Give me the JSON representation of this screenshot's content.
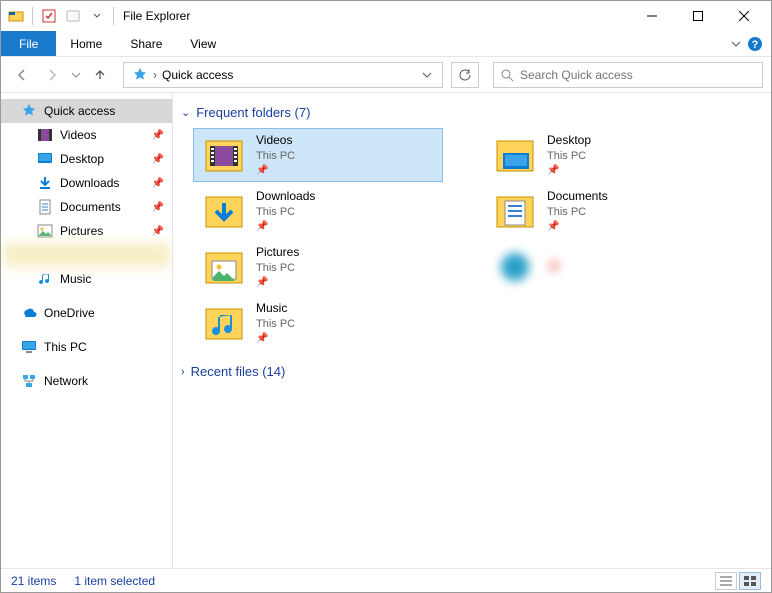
{
  "window": {
    "title": "File Explorer"
  },
  "ribbon": {
    "file": "File",
    "tabs": [
      "Home",
      "Share",
      "View"
    ]
  },
  "address": {
    "location": "Quick access"
  },
  "search": {
    "placeholder": "Search Quick access"
  },
  "sidebar": {
    "quick_access": "Quick access",
    "items": [
      {
        "label": "Videos",
        "pinned": true
      },
      {
        "label": "Desktop",
        "pinned": true
      },
      {
        "label": "Downloads",
        "pinned": true
      },
      {
        "label": "Documents",
        "pinned": true
      },
      {
        "label": "Pictures",
        "pinned": true
      }
    ],
    "music": "Music",
    "onedrive": "OneDrive",
    "thispc": "This PC",
    "network": "Network"
  },
  "groups": {
    "frequent": {
      "label": "Frequent folders",
      "count": 7
    },
    "recent": {
      "label": "Recent files",
      "count": 14
    }
  },
  "folders": [
    {
      "name": "Videos",
      "loc": "This PC",
      "selected": true
    },
    {
      "name": "Desktop",
      "loc": "This PC"
    },
    {
      "name": "Downloads",
      "loc": "This PC"
    },
    {
      "name": "Documents",
      "loc": "This PC"
    },
    {
      "name": "Pictures",
      "loc": "This PC"
    },
    {
      "name": "",
      "loc": "",
      "blur": true
    },
    {
      "name": "Music",
      "loc": "This PC"
    }
  ],
  "status": {
    "items": "21 items",
    "selected": "1 item selected"
  }
}
